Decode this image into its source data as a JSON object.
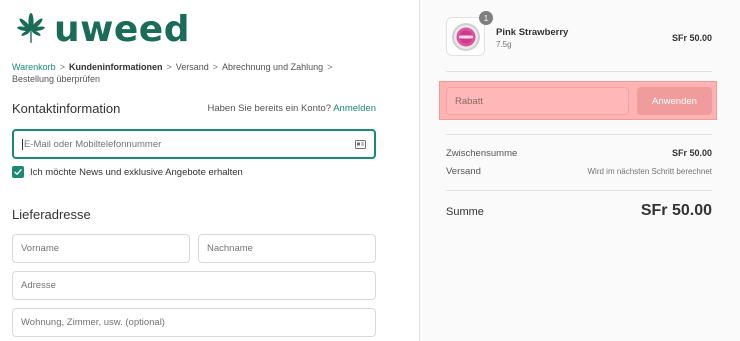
{
  "brand": {
    "name": "uweed",
    "color": "#1a6b58",
    "icon": "cannabis-leaf-icon"
  },
  "breadcrumb": {
    "items": [
      "Warenkorb",
      "Kundeninformationen",
      "Versand",
      "Abrechnung und Zahlung",
      "Bestellung überprüfen"
    ],
    "separator": ">"
  },
  "contact": {
    "title": "Kontaktinformation",
    "account_prompt": "Haben Sie bereits ein Konto?",
    "login_link": "Anmelden",
    "email_placeholder": "E-Mail oder Mobiltelefonnummer",
    "email_icon": "contact-card-icon",
    "newsletter_label": "Ich möchte News und exklusive Angebote erhalten",
    "newsletter_checked": true
  },
  "shipping": {
    "title": "Lieferadresse",
    "first_name_placeholder": "Vorname",
    "last_name_placeholder": "Nachname",
    "address_placeholder": "Adresse",
    "apartment_placeholder": "Wohnung, Zimmer, usw. (optional)"
  },
  "summary": {
    "product": {
      "quantity": "1",
      "name": "Pink Strawberry",
      "variant": "7.5g",
      "price": "SFr 50.00"
    },
    "discount": {
      "placeholder": "Rabatt",
      "button_label": "Anwenden"
    },
    "subtotal_label": "Zwischensumme",
    "subtotal_value": "SFr 50.00",
    "shipping_label": "Versand",
    "shipping_value": "Wird im nächsten Schritt berechnet",
    "total_label": "Summe",
    "total_value": "SFr 50.00"
  },
  "colors": {
    "accent": "#1a8a72",
    "highlight": "#ffb3b3"
  }
}
